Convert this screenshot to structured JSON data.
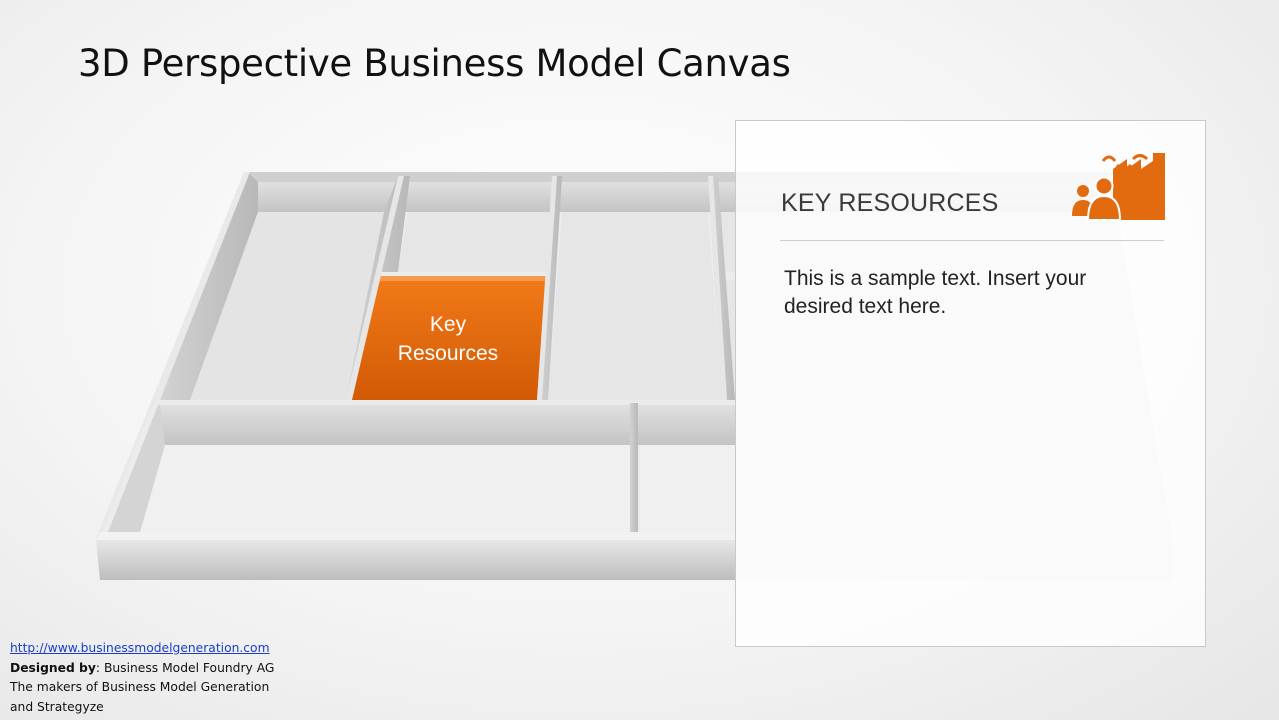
{
  "slide": {
    "title": "3D Perspective Business Model Canvas"
  },
  "canvas": {
    "highlight_label_line1": "Key",
    "highlight_label_line2": "Resources",
    "highlight_color": "#ee6d0c"
  },
  "panel": {
    "heading": "KEY RESOURCES",
    "body": "This is a sample text. Insert your desired text here.",
    "icon": "people-factory-icon",
    "icon_color": "#e26a0f"
  },
  "footer": {
    "url": "http://www.businessmodelgeneration.com",
    "designed_by_label": "Designed by",
    "designed_by_value": ": Business Model Foundry AG",
    "line3": "The makers of Business Model Generation",
    "line4": "and Strategyze"
  }
}
